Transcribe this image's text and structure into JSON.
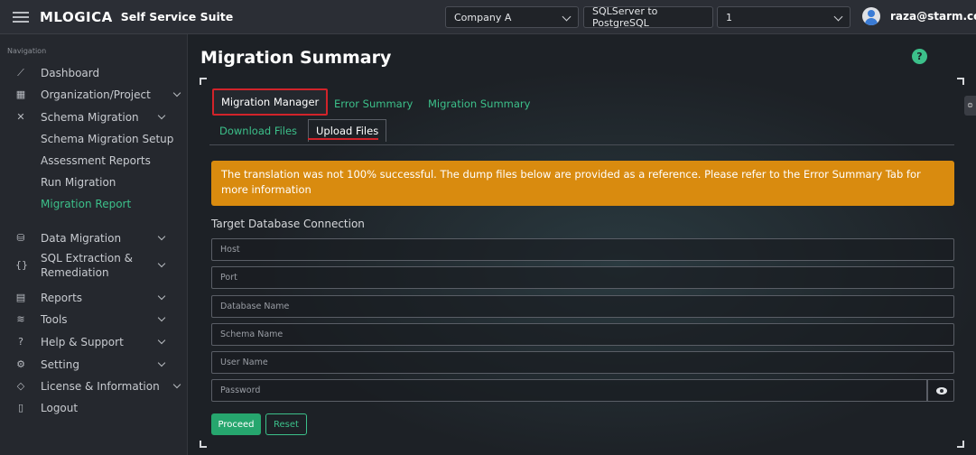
{
  "header": {
    "brand": "MLOGICA",
    "suite": "Self Service Suite",
    "company": "Company A",
    "migration_type": "SQLServer to PostgreSQL",
    "project_number": "1",
    "user_email": "raza@starm.com"
  },
  "sidebar": {
    "heading": "Navigation",
    "items": [
      {
        "label": "Dashboard",
        "icon": "chart-icon"
      },
      {
        "label": "Organization/Project",
        "icon": "grid-icon"
      },
      {
        "label": "Schema Migration",
        "icon": "tools-icon"
      },
      {
        "label": "Data Migration",
        "icon": "database-icon"
      },
      {
        "label": "SQL Extraction &",
        "label2": "Remediation",
        "icon": "braces-icon"
      },
      {
        "label": "Reports",
        "icon": "report-icon"
      },
      {
        "label": "Tools",
        "icon": "layers-icon"
      },
      {
        "label": "Help & Support",
        "icon": "help-icon"
      },
      {
        "label": "Setting",
        "icon": "gear-icon"
      },
      {
        "label": "License & Information",
        "icon": "shield-icon"
      },
      {
        "label": "Logout",
        "icon": "logout-icon"
      }
    ],
    "schema_sub": [
      "Schema Migration Setup",
      "Assessment Reports",
      "Run Migration",
      "Migration Report"
    ]
  },
  "main": {
    "title": "Migration Summary",
    "tabs": [
      "Migration Manager",
      "Error Summary",
      "Migration Summary"
    ],
    "subtabs": [
      "Download Files",
      "Upload Files"
    ],
    "alert_line1": "The translation was not 100% successful. The dump files below are provided as a reference. Please refer to the Error Summary Tab for",
    "alert_line2": "more information",
    "section_title": "Target Database Connection",
    "fields": {
      "host": "Host",
      "port": "Port",
      "database": "Database Name",
      "schema": "Schema Name",
      "user": "User Name",
      "password": "Password"
    },
    "proceed_label": "Proceed",
    "reset_label": "Reset"
  },
  "colors": {
    "accent_green": "#3cc08a",
    "alert_orange": "#d98b0f",
    "highlight_red": "#d2232a"
  }
}
